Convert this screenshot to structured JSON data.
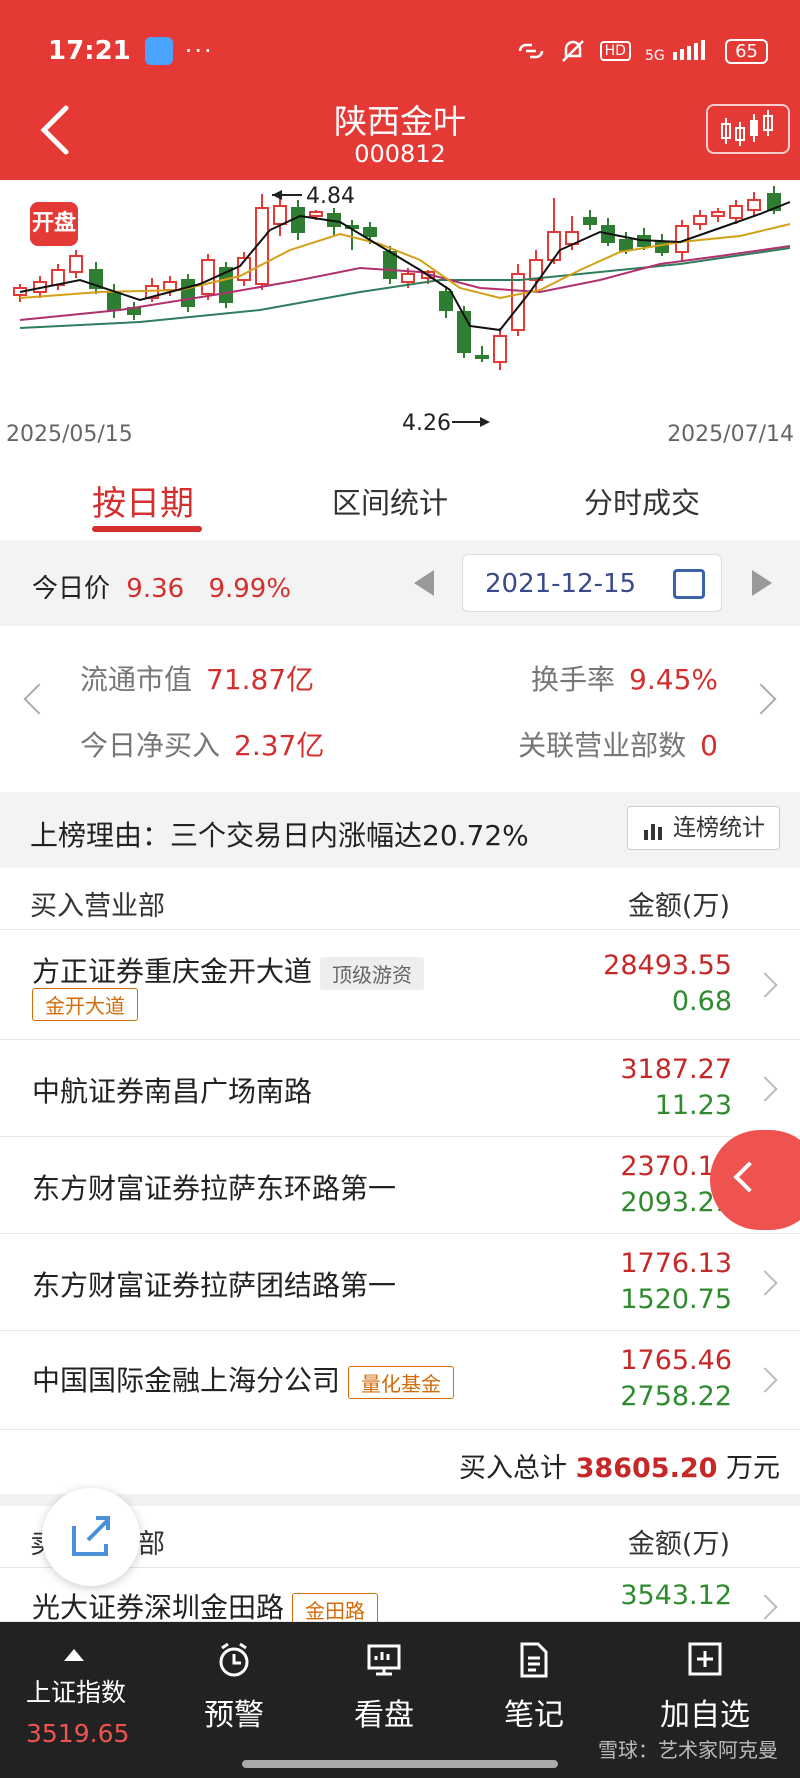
{
  "status_bar": {
    "time": "17:21",
    "dots": "···",
    "network": "5G",
    "hd": "HD",
    "battery": "65"
  },
  "header": {
    "title": "陕西金叶",
    "code": "000812"
  },
  "chart_data": {
    "type": "candlestick",
    "start_date": "2025/05/15",
    "end_date": "2025/07/14",
    "high_label": "4.84",
    "low_label": "4.26",
    "badge": "开盘",
    "colors": {
      "up": "#e53935",
      "down": "#2e7d32",
      "ma5": "#111111",
      "ma10": "#d4a017",
      "ma20": "#b03070",
      "ma60": "#2e7d5b"
    }
  },
  "tabs": [
    {
      "label": "按日期"
    },
    {
      "label": "区间统计"
    },
    {
      "label": "分时成交"
    }
  ],
  "price_bar": {
    "label": "今日价",
    "price": "9.36",
    "change": "9.99%",
    "date": "2021-12-15"
  },
  "stats": {
    "mv_label": "流通市值",
    "mv_value": "71.87亿",
    "turnover_label": "换手率",
    "turnover_value": "9.45%",
    "netbuy_label": "今日净买入",
    "netbuy_value": "2.37亿",
    "branches_label": "关联营业部数",
    "branches_value": "0"
  },
  "reason": {
    "text": "上榜理由：三个交易日内涨幅达20.72%",
    "button": "连榜统计"
  },
  "buy_section": {
    "header_left": "买入营业部",
    "header_right": "金额(万)",
    "rows": [
      {
        "name": "方正证券重庆金开大道",
        "tag_gray": "顶级游资",
        "tag_orange": "金开大道",
        "buy": "28493.55",
        "sell": "0.68"
      },
      {
        "name": "中航证券南昌广场南路",
        "buy": "3187.27",
        "sell": "11.23"
      },
      {
        "name": "东方财富证券拉萨东环路第一",
        "buy": "2370.19",
        "sell": "2093.21"
      },
      {
        "name": "东方财富证券拉萨团结路第一",
        "buy": "1776.13",
        "sell": "1520.75"
      },
      {
        "name": "中国国际金融上海分公司",
        "tag_orange": "量化基金",
        "buy": "1765.46",
        "sell": "2758.22"
      }
    ],
    "total_label": "买入总计",
    "total_value": "38605.20",
    "total_unit": "万元"
  },
  "sell_section": {
    "header_left": "卖出营业部",
    "header_right": "金额(万)",
    "rows": [
      {
        "name": "光大证券深圳金田路",
        "tag_orange": "金田路",
        "value": "3543.12"
      }
    ]
  },
  "bottom_nav": {
    "index_label": "上证指数",
    "index_value": "3519.65",
    "items": [
      {
        "label": "预警"
      },
      {
        "label": "看盘"
      },
      {
        "label": "笔记"
      },
      {
        "label": "加自选"
      }
    ]
  },
  "watermark": "雪球：艺术家阿克曼"
}
